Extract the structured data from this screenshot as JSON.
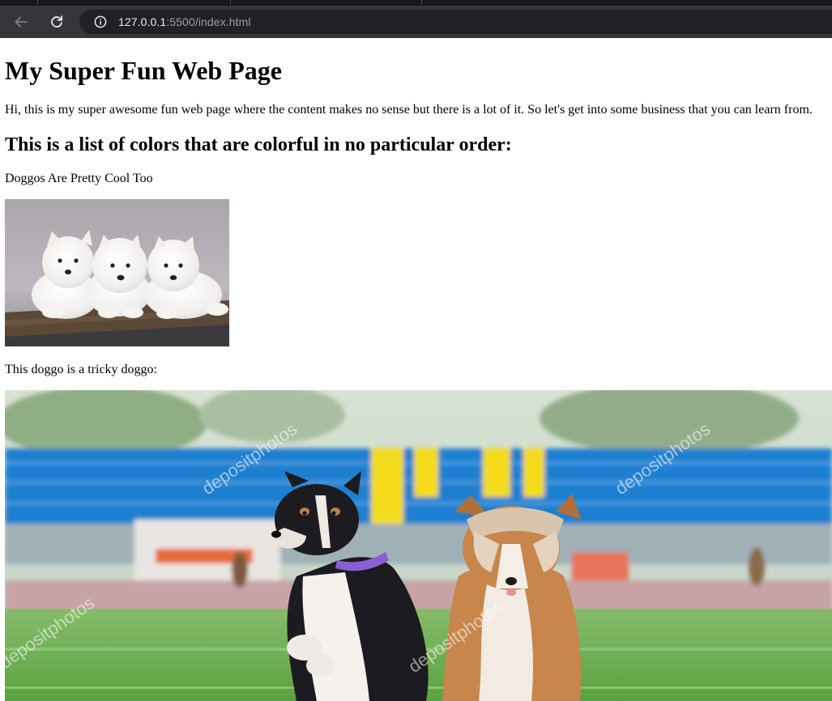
{
  "browser": {
    "url_host": "127.0.0.1",
    "url_rest": ":5500/index.html",
    "back_icon": "arrow-left-icon",
    "reload_icon": "reload-icon",
    "info_icon": "info-circle-icon"
  },
  "page": {
    "title": "My Super Fun Web Page",
    "intro": "Hi, this is my super awesome fun web page where the content makes no sense but there is a lot of it. So let's get into some business that you can learn from.",
    "list_heading": "This is a list of colors that are colorful in no particular order:",
    "doggos_caption": "Doggos Are Pretty Cool Too",
    "tricky_caption": "This doggo is a tricky doggo:",
    "watermark": "depositphotos"
  },
  "colors": {
    "chrome_bg": "#35363a",
    "omnibox_bg": "#202124",
    "stadium_blue": "#1f7fd0",
    "stadium_yellow": "#f4dc1c",
    "grass": "#6bb04a"
  }
}
